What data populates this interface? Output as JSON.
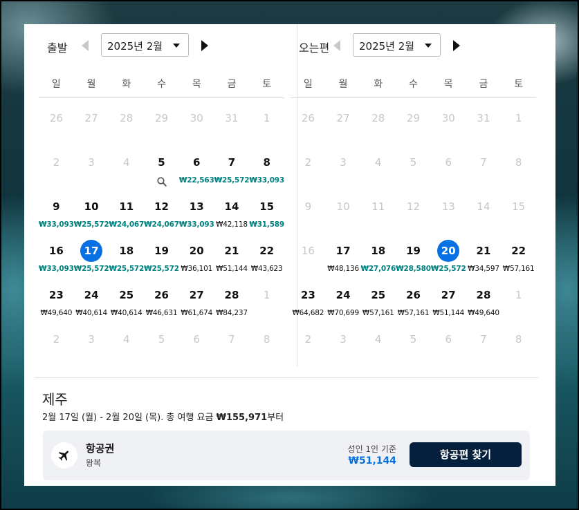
{
  "weekdays": [
    "일",
    "월",
    "화",
    "수",
    "목",
    "금",
    "토"
  ],
  "outbound": {
    "label": "출발",
    "month_select": "2025년 2월",
    "weeks": [
      [
        {
          "d": "26",
          "m": true
        },
        {
          "d": "27",
          "m": true
        },
        {
          "d": "28",
          "m": true
        },
        {
          "d": "29",
          "m": true
        },
        {
          "d": "30",
          "m": true
        },
        {
          "d": "31",
          "m": true
        },
        {
          "d": "1",
          "m": true
        }
      ],
      [
        {
          "d": "2",
          "m": true
        },
        {
          "d": "3",
          "m": true
        },
        {
          "d": "4",
          "m": true
        },
        {
          "d": "5",
          "icon": "search-icon"
        },
        {
          "d": "6",
          "p": "₩22,563",
          "low": true
        },
        {
          "d": "7",
          "p": "₩25,572",
          "low": true
        },
        {
          "d": "8",
          "p": "₩33,093",
          "low": true
        }
      ],
      [
        {
          "d": "9",
          "p": "₩33,093",
          "low": true
        },
        {
          "d": "10",
          "p": "₩25,572",
          "low": true
        },
        {
          "d": "11",
          "p": "₩24,067",
          "low": true
        },
        {
          "d": "12",
          "p": "₩24,067",
          "low": true
        },
        {
          "d": "13",
          "p": "₩33,093",
          "low": true
        },
        {
          "d": "14",
          "p": "₩42,118"
        },
        {
          "d": "15",
          "p": "₩31,589",
          "low": true
        }
      ],
      [
        {
          "d": "16",
          "p": "₩33,093",
          "low": true
        },
        {
          "d": "17",
          "p": "₩25,572",
          "low": true,
          "sel": true
        },
        {
          "d": "18",
          "p": "₩25,572",
          "low": true
        },
        {
          "d": "19",
          "p": "₩25,572",
          "low": true
        },
        {
          "d": "20",
          "p": "₩36,101"
        },
        {
          "d": "21",
          "p": "₩51,144"
        },
        {
          "d": "22",
          "p": "₩43,623"
        }
      ],
      [
        {
          "d": "23",
          "p": "₩49,640"
        },
        {
          "d": "24",
          "p": "₩40,614"
        },
        {
          "d": "25",
          "p": "₩40,614"
        },
        {
          "d": "26",
          "p": "₩46,631"
        },
        {
          "d": "27",
          "p": "₩61,674"
        },
        {
          "d": "28",
          "p": "₩84,237"
        },
        {
          "d": "1",
          "m": true
        }
      ],
      [
        {
          "d": "2",
          "m": true
        },
        {
          "d": "3",
          "m": true
        },
        {
          "d": "4",
          "m": true
        },
        {
          "d": "5",
          "m": true
        },
        {
          "d": "6",
          "m": true
        },
        {
          "d": "7",
          "m": true
        },
        {
          "d": "8",
          "m": true
        }
      ]
    ]
  },
  "inbound": {
    "label": "오는편",
    "month_select": "2025년 2월",
    "weeks": [
      [
        {
          "d": "26",
          "m": true
        },
        {
          "d": "27",
          "m": true
        },
        {
          "d": "28",
          "m": true
        },
        {
          "d": "29",
          "m": true
        },
        {
          "d": "30",
          "m": true
        },
        {
          "d": "31",
          "m": true
        },
        {
          "d": "1",
          "m": true
        }
      ],
      [
        {
          "d": "2",
          "m": true
        },
        {
          "d": "3",
          "m": true
        },
        {
          "d": "4",
          "m": true
        },
        {
          "d": "5",
          "m": true
        },
        {
          "d": "6",
          "m": true
        },
        {
          "d": "7",
          "m": true
        },
        {
          "d": "8",
          "m": true
        }
      ],
      [
        {
          "d": "9",
          "m": true
        },
        {
          "d": "10",
          "m": true
        },
        {
          "d": "11",
          "m": true
        },
        {
          "d": "12",
          "m": true
        },
        {
          "d": "13",
          "m": true
        },
        {
          "d": "14",
          "m": true
        },
        {
          "d": "15",
          "m": true
        }
      ],
      [
        {
          "d": "16",
          "m": true
        },
        {
          "d": "17",
          "p": "₩48,136"
        },
        {
          "d": "18",
          "p": "₩27,076",
          "low": true
        },
        {
          "d": "19",
          "p": "₩28,580",
          "low": true
        },
        {
          "d": "20",
          "p": "₩25,572",
          "low": true,
          "sel": true
        },
        {
          "d": "21",
          "p": "₩34,597"
        },
        {
          "d": "22",
          "p": "₩57,161"
        }
      ],
      [
        {
          "d": "23",
          "p": "₩64,682"
        },
        {
          "d": "24",
          "p": "₩70,699"
        },
        {
          "d": "25",
          "p": "₩57,161"
        },
        {
          "d": "26",
          "p": "₩57,161"
        },
        {
          "d": "27",
          "p": "₩51,144"
        },
        {
          "d": "28",
          "p": "₩49,640"
        },
        {
          "d": "1",
          "m": true
        }
      ],
      [
        {
          "d": "2",
          "m": true
        },
        {
          "d": "3",
          "m": true
        },
        {
          "d": "4",
          "m": true
        },
        {
          "d": "5",
          "m": true
        },
        {
          "d": "6",
          "m": true
        },
        {
          "d": "7",
          "m": true
        },
        {
          "d": "8",
          "m": true
        }
      ]
    ]
  },
  "summary": {
    "destination": "제주",
    "dates_text": "2월 17일 (월) - 2월 20일 (목). 총 여행 요금 ",
    "total_price": "₩155,971",
    "total_suffix": "부터"
  },
  "flight_card": {
    "icon": "airplane-icon",
    "title": "항공권",
    "subtitle": "왕복",
    "price_note": "성인 1인 기준",
    "price": "₩51,144",
    "button_label": "항공편 찾기"
  },
  "colors": {
    "accent": "#0770e3",
    "low_price": "#00807f",
    "button_bg": "#05203c"
  }
}
